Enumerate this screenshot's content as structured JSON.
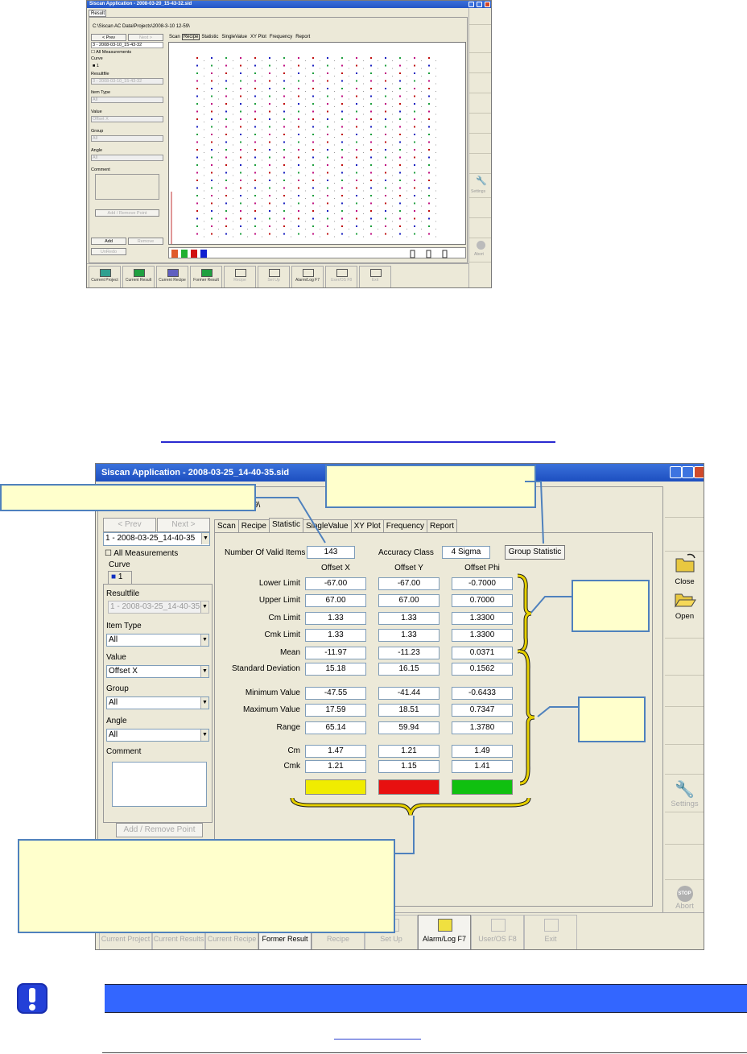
{
  "small": {
    "title": "Siscan Application - 2008-03-20_15-43-32.sid",
    "result_tab": "Result",
    "path": "C:\\Siscan AC Data\\Projects\\2008-3-10 12-59\\",
    "prev": "< Prev",
    "next": "Next >",
    "selected_run": "3 - 2008-03-10_15-43-32",
    "all_measurements": "All Measurements",
    "curve": "Curve",
    "curve_num": "1",
    "resultfile": "Resultfile",
    "resultfile_val": "3 - 2008-03-10_15-43-32",
    "item_type": "Item Type",
    "item_type_val": "All",
    "value": "Value",
    "value_val": "Offset X",
    "group": "Group",
    "group_val": "All",
    "angle": "Angle",
    "angle_val": "All",
    "comment": "Comment",
    "add_remove": "Add / Remove Point",
    "add": "Add",
    "remove": "Remove",
    "undo": "UnRedo",
    "tabs": [
      "Scan",
      "Recipe",
      "Statistic",
      "SingleValue",
      "XY Plot",
      "Frequency",
      "Report"
    ],
    "active_tab": "Recipe",
    "settings": "Settings",
    "abort": "Abort",
    "bottom": [
      "Current Project",
      "Current Result",
      "Current Recipe",
      "Former Result",
      "Recipe",
      "Set Up",
      "Alarm/Log F7",
      "User/OS F8",
      "Exit"
    ]
  },
  "large": {
    "title": "Siscan Application - 2008-03-25_14-40-35.sid",
    "path_suffix": "9\\",
    "prev": "< Prev",
    "next": "Next >",
    "selected_run": "1 - 2008-03-25_14-40-35",
    "all_measurements": "All Measurements",
    "curve": "Curve",
    "curve_num": "1",
    "resultfile": "Resultfile",
    "resultfile_val": "1 - 2008-03-25_14-40-35",
    "item_type": "Item Type",
    "item_type_val": "All",
    "value": "Value",
    "value_val": "Offset X",
    "group": "Group",
    "group_val": "All",
    "angle": "Angle",
    "angle_val": "All",
    "comment": "Comment",
    "add_remove": "Add / Remove Point",
    "tabs": [
      "Scan",
      "Recipe",
      "Statistic",
      "SingleValue",
      "XY Plot",
      "Frequency",
      "Report"
    ],
    "active_tab": "Statistic",
    "valid_items_label": "Number Of Valid Items",
    "valid_items": "143",
    "accuracy_label": "Accuracy Class",
    "accuracy": "4 Sigma",
    "group_statistic": "Group Statistic",
    "columns": [
      "Offset X",
      "Offset Y",
      "Offset Phi"
    ],
    "rows": [
      {
        "label": "Lower Limit",
        "values": [
          "-67.00",
          "-67.00",
          "-0.7000"
        ]
      },
      {
        "label": "Upper Limit",
        "values": [
          "67.00",
          "67.00",
          "0.7000"
        ]
      },
      {
        "label": "Cm Limit",
        "values": [
          "1.33",
          "1.33",
          "1.3300"
        ]
      },
      {
        "label": "Cmk Limit",
        "values": [
          "1.33",
          "1.33",
          "1.3300"
        ]
      },
      {
        "label": "Mean",
        "values": [
          "-11.97",
          "-11.23",
          "0.0371"
        ]
      },
      {
        "label": "Standard Deviation",
        "values": [
          "15.18",
          "16.15",
          "0.1562"
        ]
      },
      {
        "label": "Minimum Value",
        "values": [
          "-47.55",
          "-41.44",
          "-0.6433"
        ]
      },
      {
        "label": "Maximum Value",
        "values": [
          "17.59",
          "18.51",
          "0.7347"
        ]
      },
      {
        "label": "Range",
        "values": [
          "65.14",
          "59.94",
          "1.3780"
        ]
      },
      {
        "label": "Cm",
        "values": [
          "1.47",
          "1.21",
          "1.49"
        ]
      },
      {
        "label": "Cmk",
        "values": [
          "1.21",
          "1.15",
          "1.41"
        ]
      }
    ],
    "status_colors": [
      "#f0ec00",
      "#e81010",
      "#10c010"
    ],
    "right": {
      "close": "Close",
      "open": "Open",
      "settings": "Settings",
      "abort": "Abort",
      "stop": "STOP"
    },
    "bottom": [
      {
        "label": "Current Project",
        "enabled": false
      },
      {
        "label": "Current Results",
        "enabled": false
      },
      {
        "label": "Current Recipe",
        "enabled": false
      },
      {
        "label": "Former Result",
        "enabled": true
      },
      {
        "label": "Recipe",
        "enabled": false
      },
      {
        "label": "Set Up",
        "enabled": false
      },
      {
        "label": "Alarm/Log F7",
        "enabled": true
      },
      {
        "label": "User/OS F8",
        "enabled": false
      },
      {
        "label": "Exit",
        "enabled": false
      }
    ]
  },
  "colors": {
    "callout_fill": "#ffffcc",
    "callout_border": "#4f81bd",
    "brace": "#e6d000",
    "note_bar": "#3366ff",
    "titlebar": "#2456c6"
  }
}
